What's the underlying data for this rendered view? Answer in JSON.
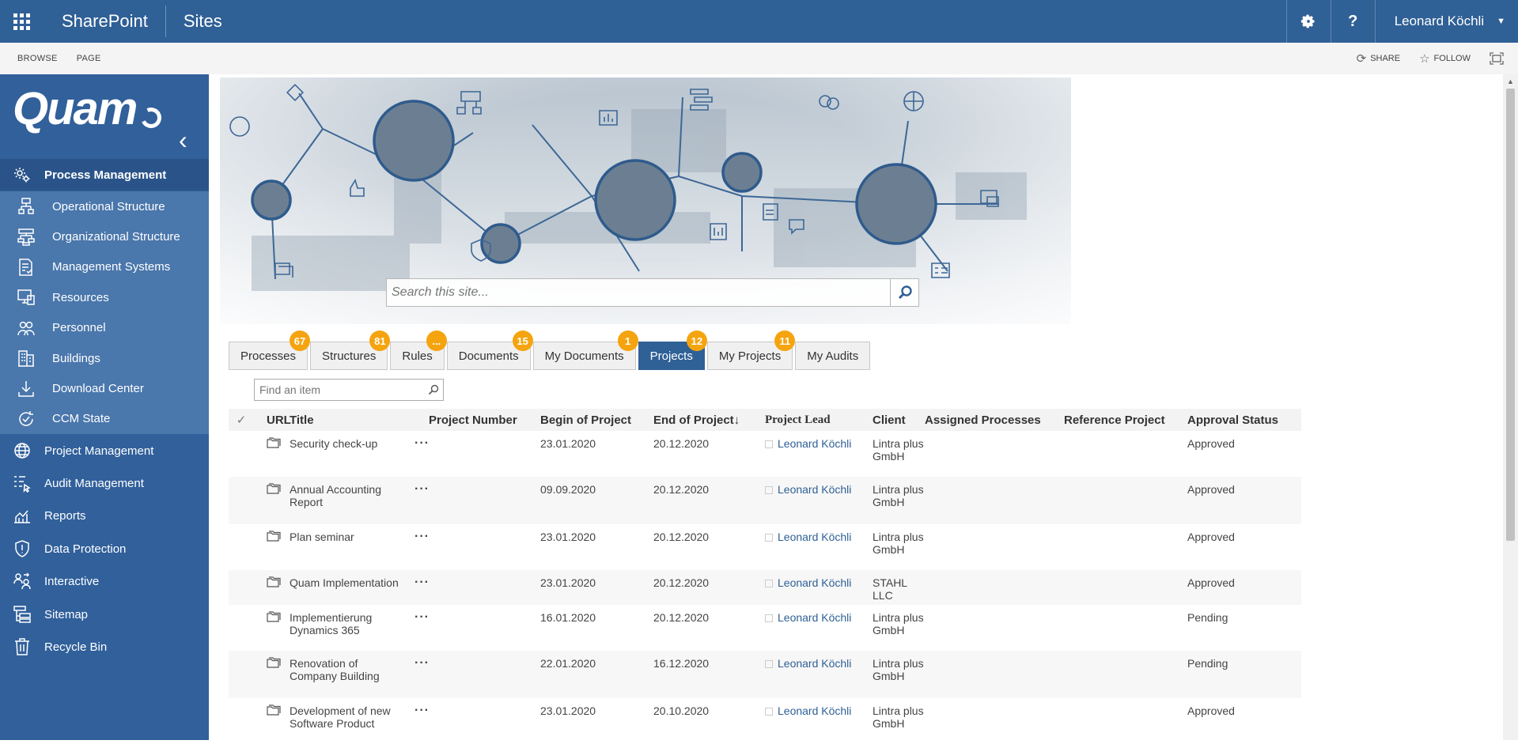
{
  "suitebar": {
    "brand": "SharePoint",
    "sites": "Sites",
    "help": "?",
    "user": "Leonard Köchli"
  },
  "ribbon": {
    "tabs": [
      "BROWSE",
      "PAGE"
    ],
    "share": "SHARE",
    "follow": "FOLLOW"
  },
  "sidebar": {
    "logo": "Quam",
    "process_management": "Process Management",
    "sub": [
      {
        "label": "Operational Structure",
        "icon": "flow-icon"
      },
      {
        "label": "Organizational Structure",
        "icon": "org-chart-icon"
      },
      {
        "label": "Management Systems",
        "icon": "document-check-icon"
      },
      {
        "label": "Resources",
        "icon": "monitor-icon"
      },
      {
        "label": "Personnel",
        "icon": "people-icon"
      },
      {
        "label": "Buildings",
        "icon": "building-icon"
      },
      {
        "label": "Download Center",
        "icon": "download-icon"
      },
      {
        "label": "CCM State",
        "icon": "cycle-icon"
      }
    ],
    "main": [
      {
        "label": "Project Management",
        "icon": "globe-icon"
      },
      {
        "label": "Audit Management",
        "icon": "audit-icon"
      },
      {
        "label": "Reports",
        "icon": "chart-icon"
      },
      {
        "label": "Data Protection",
        "icon": "shield-icon"
      },
      {
        "label": "Interactive",
        "icon": "interactive-icon"
      },
      {
        "label": "Sitemap",
        "icon": "sitemap-icon"
      },
      {
        "label": "Recycle Bin",
        "icon": "recycle-bin-icon"
      }
    ]
  },
  "search": {
    "placeholder": "Search this site..."
  },
  "tabs": [
    {
      "label": "Processes",
      "badge": "67"
    },
    {
      "label": "Structures",
      "badge": "81"
    },
    {
      "label": "Rules",
      "badge": "..."
    },
    {
      "label": "Documents",
      "badge": "15"
    },
    {
      "label": "My Documents",
      "badge": "1"
    },
    {
      "label": "Projects",
      "badge": "12"
    },
    {
      "label": "My Projects",
      "badge": "11"
    },
    {
      "label": "My Audits",
      "badge": ""
    }
  ],
  "find": {
    "placeholder": "Find an item"
  },
  "table": {
    "headers": {
      "check": "✓",
      "url": "URL",
      "title": "Title",
      "number": "Project Number",
      "begin": "Begin of Project",
      "end": "End of Project↓",
      "lead": "Project Lead",
      "client": "Client",
      "assigned": "Assigned Processes",
      "ref": "Reference Project",
      "status": "Approval Status"
    },
    "rows": [
      {
        "title": "Security check-up",
        "begin": "23.01.2020",
        "end": "20.12.2020",
        "lead": "Leonard Köchli",
        "client": "Lintra plus GmbH",
        "status": "Approved"
      },
      {
        "title": "Annual Accounting Report",
        "begin": "09.09.2020",
        "end": "20.12.2020",
        "lead": "Leonard Köchli",
        "client": "Lintra plus GmbH",
        "status": "Approved"
      },
      {
        "title": "Plan seminar",
        "begin": "23.01.2020",
        "end": "20.12.2020",
        "lead": "Leonard Köchli",
        "client": "Lintra plus GmbH",
        "status": "Approved"
      },
      {
        "title": "Quam Implementation",
        "begin": "23.01.2020",
        "end": "20.12.2020",
        "lead": "Leonard Köchli",
        "client": "STAHL LLC",
        "status": "Approved"
      },
      {
        "title": "Implementierung Dynamics 365",
        "begin": "16.01.2020",
        "end": "20.12.2020",
        "lead": "Leonard Köchli",
        "client": "Lintra plus GmbH",
        "status": "Pending"
      },
      {
        "title": "Renovation of Company Building",
        "begin": "22.01.2020",
        "end": "16.12.2020",
        "lead": "Leonard Köchli",
        "client": "Lintra plus GmbH",
        "status": "Pending"
      },
      {
        "title": "Development of new Software Product",
        "begin": "23.01.2020",
        "end": "20.10.2020",
        "lead": "Leonard Köchli",
        "client": "Lintra plus GmbH",
        "status": "Approved"
      }
    ]
  },
  "colors": {
    "suitebar": "#2f6096",
    "sidebar": "#31609b",
    "submenu": "#4a77ac",
    "badge": "#f5a40f"
  }
}
